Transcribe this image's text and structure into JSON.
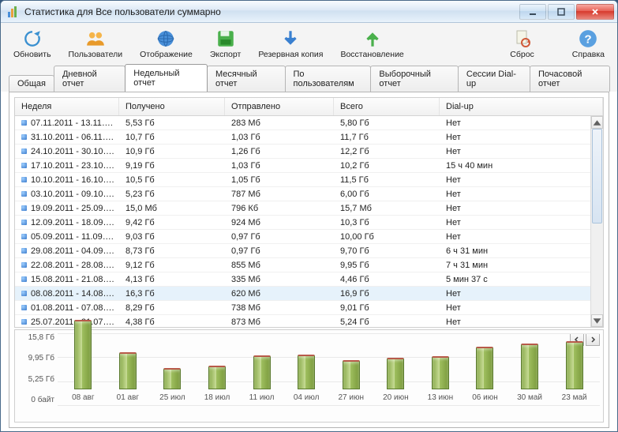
{
  "window": {
    "title": "Статистика для Все пользователи суммарно"
  },
  "toolbar": [
    {
      "id": "refresh",
      "label": "Обновить",
      "icon": "refresh"
    },
    {
      "id": "users",
      "label": "Пользователи",
      "icon": "users"
    },
    {
      "id": "display",
      "label": "Отображение",
      "icon": "globe"
    },
    {
      "id": "export",
      "label": "Экспорт",
      "icon": "save"
    },
    {
      "id": "backup",
      "label": "Резервная копия",
      "icon": "arrow-down"
    },
    {
      "id": "restore",
      "label": "Восстановление",
      "icon": "arrow-up"
    },
    {
      "id": "reset",
      "label": "Сброс",
      "icon": "doc-reset"
    },
    {
      "id": "help",
      "label": "Справка",
      "icon": "help"
    }
  ],
  "tabs": [
    {
      "id": "general",
      "label": "Общая"
    },
    {
      "id": "daily",
      "label": "Дневной отчет"
    },
    {
      "id": "weekly",
      "label": "Недельный отчет",
      "active": true
    },
    {
      "id": "monthly",
      "label": "Месячный отчет"
    },
    {
      "id": "byuser",
      "label": "По пользователям"
    },
    {
      "id": "custom",
      "label": "Выборочный отчет"
    },
    {
      "id": "dialup",
      "label": "Сессии Dial-up"
    },
    {
      "id": "hourly",
      "label": "Почасовой отчет"
    }
  ],
  "table": {
    "columns": [
      "Неделя",
      "Получено",
      "Отправлено",
      "Всего",
      "Dial-up"
    ],
    "rows": [
      [
        "07.11.2011 - 13.11….",
        "5,53 Гб",
        "283 Мб",
        "5,80 Гб",
        "Нет"
      ],
      [
        "31.10.2011 - 06.11….",
        "10,7 Гб",
        "1,03 Гб",
        "11,7 Гб",
        "Нет"
      ],
      [
        "24.10.2011 - 30.10….",
        "10,9 Гб",
        "1,26 Гб",
        "12,2 Гб",
        "Нет"
      ],
      [
        "17.10.2011 - 23.10….",
        "9,19 Гб",
        "1,03 Гб",
        "10,2 Гб",
        "15 ч 40 мин"
      ],
      [
        "10.10.2011 - 16.10….",
        "10,5 Гб",
        "1,05 Гб",
        "11,5 Гб",
        "Нет"
      ],
      [
        "03.10.2011 - 09.10….",
        "5,23 Гб",
        "787 Мб",
        "6,00 Гб",
        "Нет"
      ],
      [
        "19.09.2011 - 25.09….",
        "15,0 Мб",
        "796 Кб",
        "15,7 Мб",
        "Нет"
      ],
      [
        "12.09.2011 - 18.09….",
        "9,42 Гб",
        "924 Мб",
        "10,3 Гб",
        "Нет"
      ],
      [
        "05.09.2011 - 11.09….",
        "9,03 Гб",
        "0,97 Гб",
        "10,00 Гб",
        "Нет"
      ],
      [
        "29.08.2011 - 04.09….",
        "8,73 Гб",
        "0,97 Гб",
        "9,70 Гб",
        "6 ч 31 мин"
      ],
      [
        "22.08.2011 - 28.08….",
        "9,12 Гб",
        "855 Мб",
        "9,95 Гб",
        "7 ч 31 мин"
      ],
      [
        "15.08.2011 - 21.08….",
        "4,13 Гб",
        "335 Мб",
        "4,46 Гб",
        "5 мин 37 с"
      ],
      [
        "08.08.2011 - 14.08….",
        "16,3 Гб",
        "620 Мб",
        "16,9 Гб",
        "Нет"
      ],
      [
        "01.08.2011 - 07.08….",
        "8,29 Гб",
        "738 Мб",
        "9,01 Гб",
        "Нет"
      ],
      [
        "25.07.2011 - 31.07….",
        "4,38 Гб",
        "873 Мб",
        "5,24 Гб",
        "Нет"
      ]
    ],
    "highlighted": 12
  },
  "chart_data": {
    "type": "bar",
    "categories": [
      "08 авг",
      "01 авг",
      "25 июл",
      "18 июл",
      "11 июл",
      "04 июл",
      "27 июн",
      "20 июн",
      "13 июн",
      "06 июн",
      "30 май",
      "23 май"
    ],
    "values": [
      16.9,
      9.0,
      5.2,
      5.7,
      8.2,
      8.4,
      7.2,
      7.7,
      8.0,
      10.3,
      11.2,
      11.8
    ],
    "yticks": [
      "15,8 Гб",
      "9,95 Гб",
      "5,25 Гб",
      "0 байт"
    ],
    "ylim_gb": 16.9,
    "title": "",
    "xlabel": "",
    "ylabel": ""
  }
}
